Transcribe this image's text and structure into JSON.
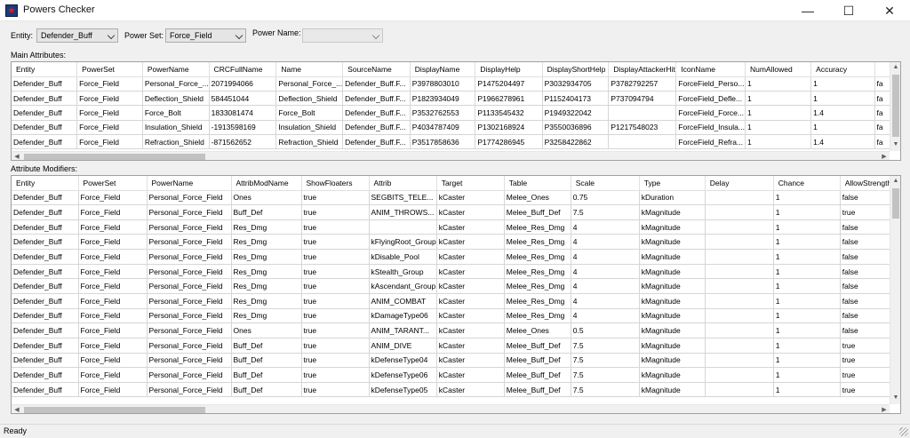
{
  "window": {
    "title": "Powers Checker"
  },
  "toolbar": {
    "entity_label": "Entity:",
    "entity_value": "Defender_Buff",
    "powerset_label": "Power Set:",
    "powerset_value": "Force_Field",
    "powername_label": "Power Name:",
    "powername_value": ""
  },
  "main": {
    "label": "Main Attributes:",
    "columns": [
      "Entity",
      "PowerSet",
      "PowerName",
      "CRCFullName",
      "Name",
      "SourceName",
      "DisplayName",
      "DisplayHelp",
      "DisplayShortHelp",
      "DisplayAttackerHit",
      "IconName",
      "NumAllowed",
      "Accuracy",
      ""
    ],
    "rows": [
      [
        "Defender_Buff",
        "Force_Field",
        "Personal_Force_...",
        "2071994066",
        "Personal_Force_...",
        "Defender_Buff.F...",
        "P3978803010",
        "P1475204497",
        "P3032934705",
        "P3782792257",
        "ForceField_Perso...",
        "1",
        "1",
        "fa"
      ],
      [
        "Defender_Buff",
        "Force_Field",
        "Deflection_Shield",
        "584451044",
        "Deflection_Shield",
        "Defender_Buff.F...",
        "P1823934049",
        "P1966278961",
        "P1152404173",
        "P737094794",
        "ForceField_Defle...",
        "1",
        "1",
        "fa"
      ],
      [
        "Defender_Buff",
        "Force_Field",
        "Force_Bolt",
        "1833081474",
        "Force_Bolt",
        "Defender_Buff.F...",
        "P3532762553",
        "P1133545432",
        "P1949322042",
        "",
        "ForceField_Force...",
        "1",
        "1.4",
        "fa"
      ],
      [
        "Defender_Buff",
        "Force_Field",
        "Insulation_Shield",
        "-1913598169",
        "Insulation_Shield",
        "Defender_Buff.F...",
        "P4034787409",
        "P1302168924",
        "P3550036896",
        "P1217548023",
        "ForceField_Insula...",
        "1",
        "1",
        "fa"
      ],
      [
        "Defender_Buff",
        "Force_Field",
        "Refraction_Shield",
        "-871562652",
        "Refraction_Shield",
        "Defender_Buff.F...",
        "P3517858636",
        "P1774286945",
        "P3258422862",
        "",
        "ForceField_Refra...",
        "1",
        "1.4",
        "fa"
      ]
    ]
  },
  "mods": {
    "label": "Attribute Modifiers:",
    "columns": [
      "Entity",
      "PowerSet",
      "PowerName",
      "AttribModName",
      "ShowFloaters",
      "Attrib",
      "Target",
      "Table",
      "Scale",
      "Type",
      "Delay",
      "Chance",
      "AllowStrength"
    ],
    "rows": [
      [
        "Defender_Buff",
        "Force_Field",
        "Personal_Force_Field",
        "Ones",
        "true",
        "SEGBITS_TELE...",
        "kCaster",
        "Melee_Ones",
        "0.75",
        "kDuration",
        "",
        "1",
        "false"
      ],
      [
        "Defender_Buff",
        "Force_Field",
        "Personal_Force_Field",
        "Buff_Def",
        "true",
        "ANIM_THROWS...",
        "kCaster",
        "Melee_Buff_Def",
        "7.5",
        "kMagnitude",
        "",
        "1",
        "true"
      ],
      [
        "Defender_Buff",
        "Force_Field",
        "Personal_Force_Field",
        "Res_Dmg",
        "true",
        "",
        "kCaster",
        "Melee_Res_Dmg",
        "4",
        "kMagnitude",
        "",
        "1",
        "false"
      ],
      [
        "Defender_Buff",
        "Force_Field",
        "Personal_Force_Field",
        "Res_Dmg",
        "true",
        "kFlyingRoot_Group",
        "kCaster",
        "Melee_Res_Dmg",
        "4",
        "kMagnitude",
        "",
        "1",
        "false"
      ],
      [
        "Defender_Buff",
        "Force_Field",
        "Personal_Force_Field",
        "Res_Dmg",
        "true",
        "kDisable_Pool",
        "kCaster",
        "Melee_Res_Dmg",
        "4",
        "kMagnitude",
        "",
        "1",
        "false"
      ],
      [
        "Defender_Buff",
        "Force_Field",
        "Personal_Force_Field",
        "Res_Dmg",
        "true",
        "kStealth_Group",
        "kCaster",
        "Melee_Res_Dmg",
        "4",
        "kMagnitude",
        "",
        "1",
        "false"
      ],
      [
        "Defender_Buff",
        "Force_Field",
        "Personal_Force_Field",
        "Res_Dmg",
        "true",
        "kAscendant_Group",
        "kCaster",
        "Melee_Res_Dmg",
        "4",
        "kMagnitude",
        "",
        "1",
        "false"
      ],
      [
        "Defender_Buff",
        "Force_Field",
        "Personal_Force_Field",
        "Res_Dmg",
        "true",
        "ANIM_COMBAT",
        "kCaster",
        "Melee_Res_Dmg",
        "4",
        "kMagnitude",
        "",
        "1",
        "false"
      ],
      [
        "Defender_Buff",
        "Force_Field",
        "Personal_Force_Field",
        "Res_Dmg",
        "true",
        "kDamageType06",
        "kCaster",
        "Melee_Res_Dmg",
        "4",
        "kMagnitude",
        "",
        "1",
        "false"
      ],
      [
        "Defender_Buff",
        "Force_Field",
        "Personal_Force_Field",
        "Ones",
        "true",
        "ANIM_TARANT...",
        "kCaster",
        "Melee_Ones",
        "0.5",
        "kMagnitude",
        "",
        "1",
        "false"
      ],
      [
        "Defender_Buff",
        "Force_Field",
        "Personal_Force_Field",
        "Buff_Def",
        "true",
        "ANIM_DIVE",
        "kCaster",
        "Melee_Buff_Def",
        "7.5",
        "kMagnitude",
        "",
        "1",
        "true"
      ],
      [
        "Defender_Buff",
        "Force_Field",
        "Personal_Force_Field",
        "Buff_Def",
        "true",
        "kDefenseType04",
        "kCaster",
        "Melee_Buff_Def",
        "7.5",
        "kMagnitude",
        "",
        "1",
        "true"
      ],
      [
        "Defender_Buff",
        "Force_Field",
        "Personal_Force_Field",
        "Buff_Def",
        "true",
        "kDefenseType06",
        "kCaster",
        "Melee_Buff_Def",
        "7.5",
        "kMagnitude",
        "",
        "1",
        "true"
      ],
      [
        "Defender_Buff",
        "Force_Field",
        "Personal_Force_Field",
        "Buff_Def",
        "true",
        "kDefenseType05",
        "kCaster",
        "Melee_Buff_Def",
        "7.5",
        "kMagnitude",
        "",
        "1",
        "true"
      ]
    ]
  },
  "status": {
    "text": "Ready"
  }
}
